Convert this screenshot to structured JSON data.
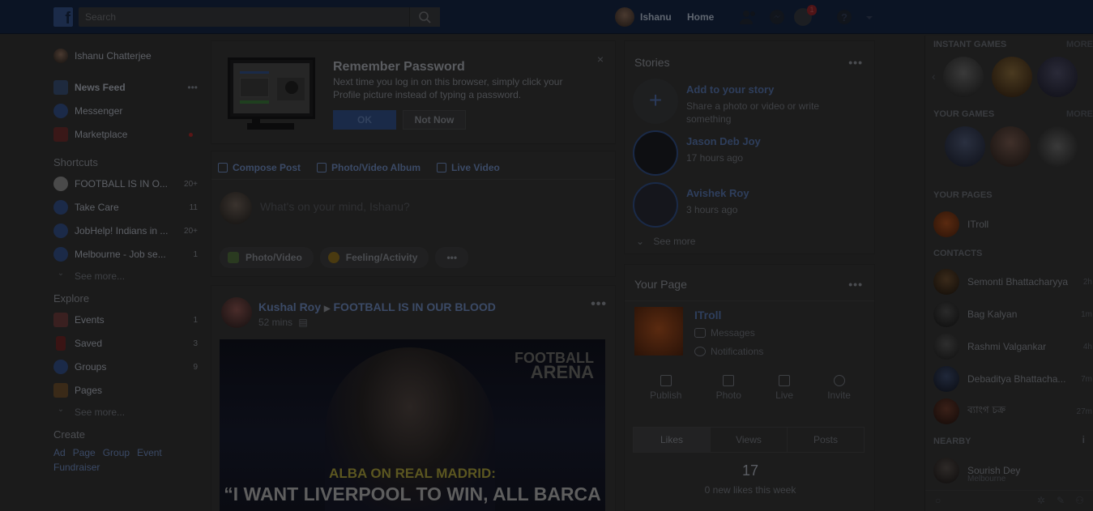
{
  "topbar": {
    "logo": "f",
    "search_placeholder": "Search",
    "user_name": "Ishanu",
    "home_label": "Home",
    "notification_count": "1"
  },
  "leftnav": {
    "profile_name": "Ishanu Chatterjee",
    "main_items": [
      {
        "label": "News Feed",
        "more": "•••"
      },
      {
        "label": "Messenger"
      },
      {
        "label": "Marketplace"
      }
    ],
    "shortcuts_title": "Shortcuts",
    "shortcuts": [
      {
        "label": "FOOTBALL IS IN O...",
        "count": "20+"
      },
      {
        "label": "Take Care",
        "count": "11"
      },
      {
        "label": "JobHelp! Indians in ...",
        "count": "20+"
      },
      {
        "label": "Melbourne - Job se...",
        "count": "1"
      }
    ],
    "see_more_1": "See more...",
    "explore_title": "Explore",
    "explore": [
      {
        "label": "Events",
        "count": "1"
      },
      {
        "label": "Saved",
        "count": "3"
      },
      {
        "label": "Groups",
        "count": "9"
      },
      {
        "label": "Pages",
        "count": ""
      }
    ],
    "see_more_2": "See more...",
    "create_title": "Create",
    "create_links": [
      "Ad",
      "Page",
      "Group",
      "Event",
      "Fundraiser"
    ]
  },
  "remember": {
    "title": "Remember Password",
    "text": "Next time you log in on this browser, simply click your Profile picture instead of typing a password.",
    "ok": "OK",
    "not_now": "Not Now",
    "close": "×"
  },
  "composer": {
    "tabs": [
      "Compose Post",
      "Photo/Video Album",
      "Live Video"
    ],
    "placeholder": "What's on your mind, Ishanu?",
    "pills": [
      "Photo/Video",
      "Feeling/Activity",
      "•••"
    ]
  },
  "post": {
    "author": "Kushal Roy",
    "target": "FOOTBALL IS IN OUR BLOOD",
    "time": "52 mins",
    "more": "•••",
    "image_logo_1": "FOOTBALL",
    "image_logo_2": "ARENA",
    "caption_1": "ALBA ON REAL MADRID:",
    "caption_2": "“I WANT LIVERPOOL TO WIN, ALL BARCA"
  },
  "stories": {
    "title": "Stories",
    "more": "•••",
    "add_title": "Add to your story",
    "add_sub": "Share a photo or video or write something",
    "items": [
      {
        "name": "Jason Deb Joy",
        "time": "17 hours ago"
      },
      {
        "name": "Avishek Roy",
        "time": "3 hours ago"
      }
    ],
    "see_more": "See more"
  },
  "your_page": {
    "title": "Your Page",
    "more": "•••",
    "name": "ITroll",
    "messages": "Messages",
    "notifications": "Notifications",
    "actions": [
      "Publish",
      "Photo",
      "Live",
      "Invite"
    ],
    "stat_tabs": [
      "Likes",
      "Views",
      "Posts"
    ],
    "stat_value": "17",
    "stat_sub": "0 new likes this week"
  },
  "sidebar": {
    "instant_games": "INSTANT GAMES",
    "your_games": "YOUR GAMES",
    "more_label": "MORE",
    "your_pages": "YOUR PAGES",
    "page_item": "ITroll",
    "contacts_title": "CONTACTS",
    "contacts": [
      {
        "name": "Semonti Bhattacharyya",
        "time": "2h"
      },
      {
        "name": "Bag Kalyan",
        "time": "1m"
      },
      {
        "name": "Rashmi Valgankar",
        "time": "4h"
      },
      {
        "name": "Debaditya Bhattacha...",
        "time": "7m"
      },
      {
        "name": "ব্যাংগ চক্র",
        "time": "27m"
      }
    ],
    "nearby_title": "NEARBY",
    "nearby": {
      "name": "Sourish Dey",
      "location": "Melbourne"
    }
  }
}
